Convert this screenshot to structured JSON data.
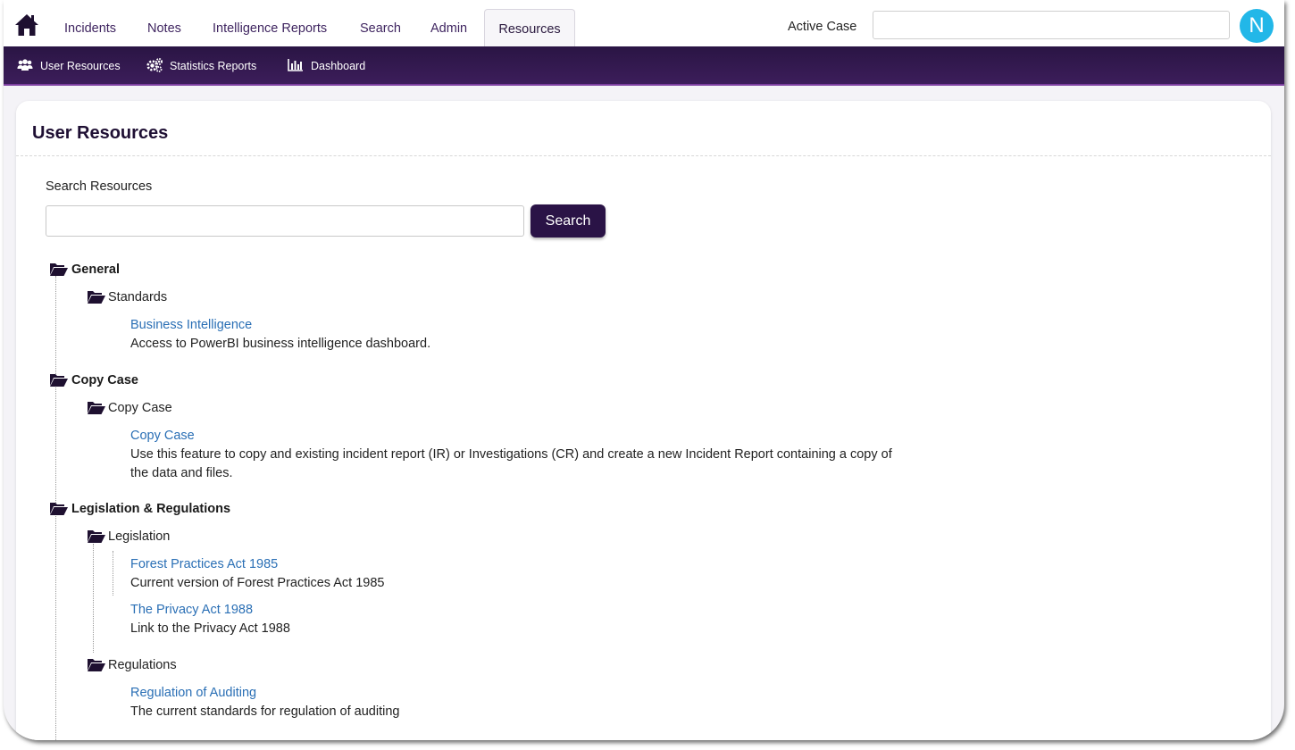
{
  "nav": {
    "tabs": [
      "Incidents",
      "Notes",
      "Intelligence Reports",
      "Search",
      "Admin",
      "Resources"
    ],
    "active_tab": "Resources",
    "active_case_label": "Active Case",
    "active_case_value": "",
    "avatar_initial": "N"
  },
  "subnav": {
    "items": [
      "User Resources",
      "Statistics Reports",
      "Dashboard"
    ]
  },
  "page": {
    "title": "User Resources",
    "search_label": "Search Resources",
    "search_value": "",
    "search_button": "Search"
  },
  "tree": [
    {
      "category": "General",
      "subs": [
        {
          "name": "Standards",
          "items": [
            {
              "link": "Business Intelligence",
              "desc": "Access to PowerBI business intelligence dashboard."
            }
          ]
        }
      ]
    },
    {
      "category": "Copy Case",
      "subs": [
        {
          "name": "Copy Case",
          "items": [
            {
              "link": "Copy Case",
              "desc": "Use this feature to copy and existing incident report (IR) or Investigations (CR) and create a new Incident Report containing a copy of the data and files."
            }
          ]
        }
      ]
    },
    {
      "category": "Legislation & Regulations",
      "subs": [
        {
          "name": "Legislation",
          "items": [
            {
              "link": "Forest Practices Act 1985",
              "desc": "Current version of Forest Practices Act 1985"
            },
            {
              "link": "The Privacy Act 1988",
              "desc": "Link to the Privacy Act 1988"
            }
          ]
        },
        {
          "name": "Regulations",
          "items": [
            {
              "link": "Regulation of Auditing",
              "desc": "The current standards for regulation of auditing"
            }
          ]
        }
      ]
    }
  ],
  "colors": {
    "brand_dark": "#2a1346",
    "link": "#2a6fb5",
    "avatar": "#22b7e8"
  },
  "icons": [
    "home-icon",
    "users-icon",
    "gears-icon",
    "bar-chart-icon",
    "folder-open-icon"
  ]
}
